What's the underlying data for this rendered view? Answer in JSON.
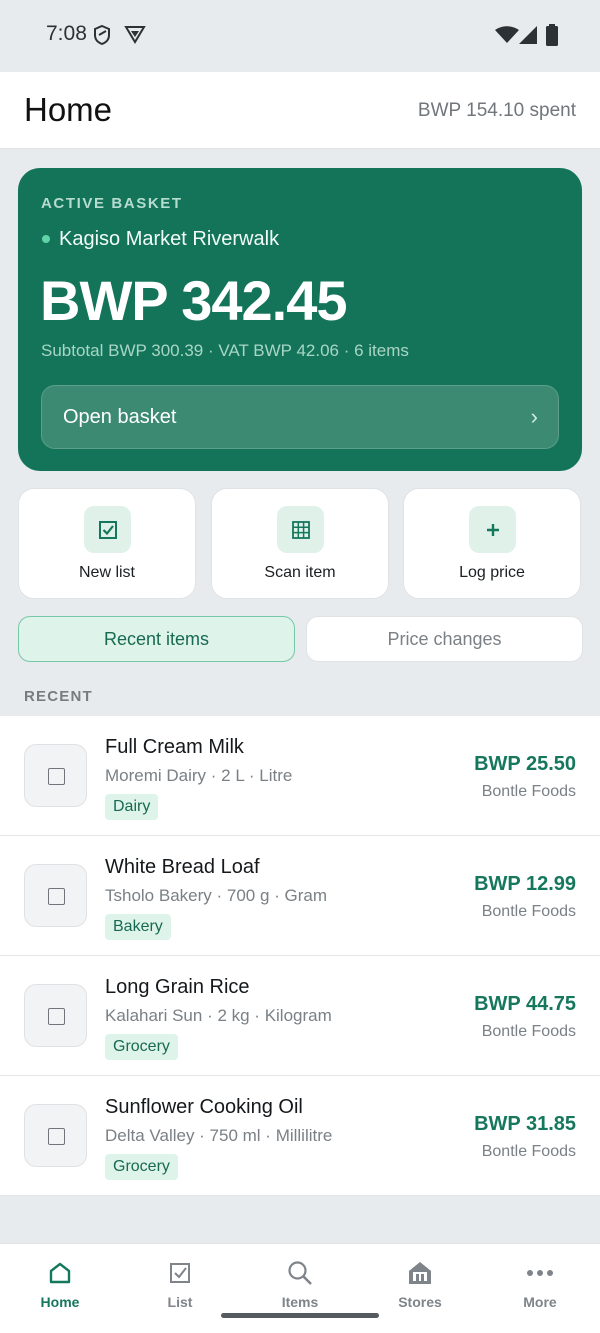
{
  "status_bar": {
    "time": "7:08"
  },
  "header": {
    "title": "Home",
    "spent": "BWP 154.10 spent"
  },
  "basket": {
    "label": "ACTIVE BASKET",
    "store": "Kagiso Market Riverwalk",
    "total": "BWP 342.45",
    "summary": "Subtotal BWP 300.39 · VAT BWP 42.06 · 6 items",
    "open_label": "Open basket",
    "chevron": "›"
  },
  "quick_actions": [
    {
      "label": "New list",
      "icon": "checklist-icon"
    },
    {
      "label": "Scan item",
      "icon": "barcode-grid-icon"
    },
    {
      "label": "Log price",
      "icon": "plus-icon"
    }
  ],
  "tabs": [
    {
      "label": "Recent items",
      "active": true
    },
    {
      "label": "Price changes",
      "active": false
    }
  ],
  "section_label": "RECENT",
  "items": [
    {
      "name": "Full Cream Milk",
      "meta": "Moremi Dairy · 2 L · Litre",
      "tag": "Dairy",
      "price": "BWP 25.50",
      "store": "Bontle Foods"
    },
    {
      "name": "White Bread Loaf",
      "meta": "Tsholo Bakery · 700 g · Gram",
      "tag": "Bakery",
      "price": "BWP 12.99",
      "store": "Bontle Foods"
    },
    {
      "name": "Long Grain Rice",
      "meta": "Kalahari Sun · 2 kg · Kilogram",
      "tag": "Grocery",
      "price": "BWP 44.75",
      "store": "Bontle Foods"
    },
    {
      "name": "Sunflower Cooking Oil",
      "meta": "Delta Valley · 750 ml · Millilitre",
      "tag": "Grocery",
      "price": "BWP 31.85",
      "store": "Bontle Foods"
    }
  ],
  "nav": [
    {
      "label": "Home",
      "icon": "home-icon",
      "active": true
    },
    {
      "label": "List",
      "icon": "checklist-icon",
      "active": false
    },
    {
      "label": "Items",
      "icon": "search-icon",
      "active": false
    },
    {
      "label": "Stores",
      "icon": "store-icon",
      "active": false
    },
    {
      "label": "More",
      "icon": "more-icon",
      "active": false
    }
  ],
  "colors": {
    "brand": "#13745a",
    "accent": "#15775b",
    "tag_bg": "#def3ea"
  }
}
